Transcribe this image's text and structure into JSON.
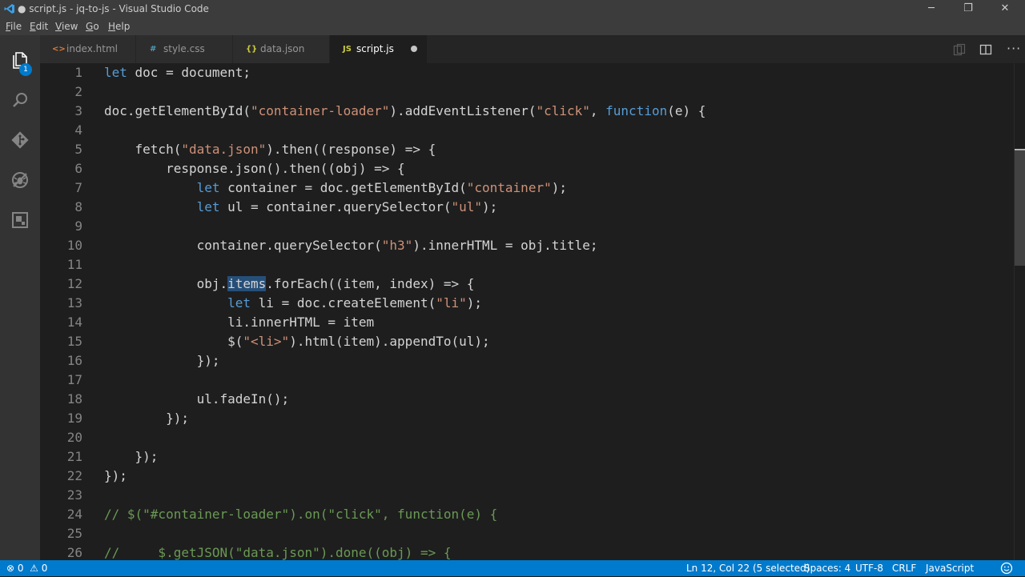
{
  "window": {
    "title": "● script.js - jq-to-js - Visual Studio Code",
    "controls": {
      "minimize": "─",
      "restore": "❐",
      "close": "✕"
    }
  },
  "menu": [
    {
      "label": "File",
      "mnemonic": "F",
      "rest": "ile"
    },
    {
      "label": "Edit",
      "mnemonic": "E",
      "rest": "dit"
    },
    {
      "label": "View",
      "mnemonic": "V",
      "rest": "iew"
    },
    {
      "label": "Go",
      "mnemonic": "G",
      "rest": "o"
    },
    {
      "label": "Help",
      "mnemonic": "H",
      "rest": "elp"
    }
  ],
  "activity": {
    "explorer_badge": "1",
    "icons": [
      "files-icon",
      "search-icon",
      "source-control-icon",
      "debug-icon",
      "extensions-icon"
    ]
  },
  "tabs": [
    {
      "label": "index.html",
      "icon": "<>",
      "icon_color": "#e37933",
      "active": false
    },
    {
      "label": "style.css",
      "icon": "#",
      "icon_color": "#519aba",
      "active": false
    },
    {
      "label": "data.json",
      "icon": "{}",
      "icon_color": "#cbcb41",
      "active": false
    },
    {
      "label": "script.js",
      "icon": "JS",
      "icon_color": "#cbcb41",
      "active": true,
      "dirty": true
    }
  ],
  "editor": {
    "lines": [
      {
        "n": "1",
        "code": "let doc = document;"
      },
      {
        "n": "2",
        "code": ""
      },
      {
        "n": "3",
        "code": "doc.getElementById(\"container-loader\").addEventListener(\"click\", function(e) {"
      },
      {
        "n": "4",
        "code": ""
      },
      {
        "n": "5",
        "code": "    fetch(\"data.json\").then((response) => {"
      },
      {
        "n": "6",
        "code": "        response.json().then((obj) => {"
      },
      {
        "n": "7",
        "code": "            let container = doc.getElementById(\"container\");"
      },
      {
        "n": "8",
        "code": "            let ul = container.querySelector(\"ul\");"
      },
      {
        "n": "9",
        "code": ""
      },
      {
        "n": "10",
        "code": "            container.querySelector(\"h3\").innerHTML = obj.title;"
      },
      {
        "n": "11",
        "code": ""
      },
      {
        "n": "12",
        "code": "            obj.items.forEach((item, index) => {"
      },
      {
        "n": "13",
        "code": "                let li = doc.createElement(\"li\");"
      },
      {
        "n": "14",
        "code": "                li.innerHTML = item"
      },
      {
        "n": "15",
        "code": "                $(\"<li>\").html(item).appendTo(ul);"
      },
      {
        "n": "16",
        "code": "            });"
      },
      {
        "n": "17",
        "code": ""
      },
      {
        "n": "18",
        "code": "            ul.fadeIn();"
      },
      {
        "n": "19",
        "code": "        });"
      },
      {
        "n": "20",
        "code": ""
      },
      {
        "n": "21",
        "code": "    });"
      },
      {
        "n": "22",
        "code": "});"
      },
      {
        "n": "23",
        "code": ""
      },
      {
        "n": "24",
        "code": "// $(\"#container-loader\").on(\"click\", function(e) {"
      },
      {
        "n": "25",
        "code": ""
      },
      {
        "n": "26",
        "code": "//     $.getJSON(\"data.json\").done((obj) => {"
      }
    ],
    "selection": {
      "line": 12,
      "text": "items"
    }
  },
  "status": {
    "errors": "0",
    "warnings": "0",
    "position": "Ln 12, Col 22 (5 selected)",
    "spaces": "Spaces: 4",
    "encoding": "UTF-8",
    "eol": "CRLF",
    "language": "JavaScript",
    "feedback_icon": "smiley-icon"
  },
  "colors": {
    "accent": "#007acc",
    "keyword": "#569cd6",
    "string": "#ce9178",
    "comment": "#6a9955",
    "selection": "#264f78"
  }
}
